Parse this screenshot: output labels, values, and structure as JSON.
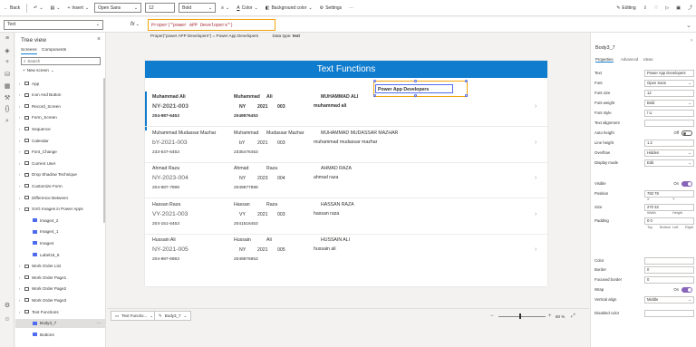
{
  "toolbar": {
    "back": "Back",
    "insert": "Insert",
    "font_family": "Open Sans",
    "font_size": "12",
    "font_weight": "Bold",
    "color": "Color",
    "background_color": "Background color",
    "settings": "Settings",
    "editing": "Editing"
  },
  "formula_bar": {
    "property": "Text",
    "fx": "fx",
    "formula": "Proper(\"power APP Developers\")",
    "hint": "Proper(\"power APP Developers\") = Power App Developers",
    "datatype_label": "Data type:",
    "datatype_value": "text"
  },
  "tree": {
    "title": "Tree view",
    "tab_screens": "Screens",
    "tab_components": "Components",
    "search_placeholder": "Search",
    "new_screen": "New screen",
    "items": [
      {
        "label": "App",
        "indent": 0
      },
      {
        "label": "Icon And Button",
        "indent": 0
      },
      {
        "label": "Record_Screen",
        "indent": 0
      },
      {
        "label": "Form_Screen",
        "indent": 0
      },
      {
        "label": "Sequence",
        "indent": 0
      },
      {
        "label": "Calendar",
        "indent": 0
      },
      {
        "label": "Font_Change",
        "indent": 0
      },
      {
        "label": "Current User",
        "indent": 0
      },
      {
        "label": "Drop Shadow Technique",
        "indent": 0
      },
      {
        "label": "Customize Form",
        "indent": 0
      },
      {
        "label": "Difference Between",
        "indent": 0
      },
      {
        "label": "SVG Images in Power Apps",
        "indent": 0
      },
      {
        "label": "Image4_2",
        "indent": 1
      },
      {
        "label": "Image4_1",
        "indent": 1
      },
      {
        "label": "Image4",
        "indent": 1
      },
      {
        "label": "Label16_6",
        "indent": 1
      },
      {
        "label": "Work Order List",
        "indent": 0
      },
      {
        "label": "Work Order Page1",
        "indent": 0
      },
      {
        "label": "Work Order Page2",
        "indent": 0
      },
      {
        "label": "Work Order Page3",
        "indent": 0
      },
      {
        "label": "Text Functions",
        "indent": 0
      },
      {
        "label": "Body3_7",
        "indent": 1
      },
      {
        "label": "Button4",
        "indent": 1
      }
    ]
  },
  "canvas": {
    "title": "Text Functions",
    "selected_label": "Power App Developers",
    "rows": [
      {
        "c1_name": "Muhammad Ali",
        "c1_code": "NY-2021-003",
        "c1_phone": "204-987-6453",
        "c2_first": "Muhammad",
        "c2_last": "Ali",
        "c2_a": "NY",
        "c2_b": "2021",
        "c2_c": "003",
        "c2_phone": "2049876453",
        "c3_upper": "MUHAMMAD ALI",
        "c3_lower": "muhammad ali"
      },
      {
        "c1_name": "Muhammad Mudassar Mazhar",
        "c1_code": "bY-2021-003",
        "c1_phone": "233-547-6453",
        "c2_first": "Muhammad",
        "c2_last": "Mudassar Mazhar",
        "c2_a": "bY",
        "c2_b": "2021",
        "c2_c": "003",
        "c2_phone": "2335476453",
        "c3_upper": "MUHAMMAD MUDASSAR MAZHAR",
        "c3_lower": "muhammad mudassar mazhar"
      },
      {
        "c1_name": "Ahmad Raza",
        "c1_code": "NY-2023-004",
        "c1_phone": "204-987-7898",
        "c2_first": "Ahmad",
        "c2_last": "Raza",
        "c2_a": "NY",
        "c2_b": "2023",
        "c2_c": "004",
        "c2_phone": "2049877898",
        "c3_upper": "AHMAD RAZA",
        "c3_lower": "ahmad raza"
      },
      {
        "c1_name": "Hassan Raza",
        "c1_code": "VY-2021-003",
        "c1_phone": "204-151-6453",
        "c2_first": "Hassan",
        "c2_last": "Raza",
        "c2_a": "VY",
        "c2_b": "2021",
        "c2_c": "003",
        "c2_phone": "2041516453",
        "c3_upper": "HASSAN RAZA",
        "c3_lower": "hassan raza"
      },
      {
        "c1_name": "Hussain Ali",
        "c1_code": "NY-2021-005",
        "c1_phone": "204-987-6953",
        "c2_first": "Hussain",
        "c2_last": "Ali",
        "c2_a": "NY",
        "c2_b": "2021",
        "c2_c": "005",
        "c2_phone": "2049876953",
        "c3_upper": "HUSSAIN ALI",
        "c3_lower": "hussain ali"
      }
    ]
  },
  "bottom": {
    "screen_tab": "Text Functio...",
    "control_tab": "Body3_7",
    "zoom": "60 %"
  },
  "props": {
    "control_name": "Body3_7",
    "tab_properties": "Properties",
    "tab_advanced": "Advanced",
    "tab_ideas": "Ideas",
    "rows": [
      {
        "label": "Text",
        "value": "Power App Developers"
      },
      {
        "label": "Font",
        "value": "Open Sans"
      },
      {
        "label": "Font size",
        "value": "12"
      },
      {
        "label": "Font weight",
        "value": "Bold"
      },
      {
        "label": "Font style",
        "value": "/   U"
      },
      {
        "label": "Text alignment",
        "value": ""
      },
      {
        "label": "Auto height",
        "value": "Off"
      },
      {
        "label": "Line height",
        "value": "1.2"
      },
      {
        "label": "Overflow",
        "value": "Hidden"
      },
      {
        "label": "Display mode",
        "value": "Edit"
      },
      {
        "label": "Visible",
        "value": "On"
      },
      {
        "label": "Position",
        "value": "783   78"
      },
      {
        "label": "Size",
        "value": "270   32"
      },
      {
        "label": "Padding",
        "value": "0   0"
      },
      {
        "label": "Color",
        "value": ""
      },
      {
        "label": "Border",
        "value": "0"
      },
      {
        "label": "Focused border",
        "value": "0"
      },
      {
        "label": "Wrap",
        "value": "On"
      },
      {
        "label": "Vertical align",
        "value": "Middle"
      },
      {
        "label": "Disabled color",
        "value": ""
      }
    ],
    "sub_xy": [
      "X",
      "Y"
    ],
    "sub_wh": [
      "Width",
      "Height"
    ],
    "sub_pad": [
      "Top",
      "Bottom",
      "Left",
      "Right"
    ]
  },
  "colors": {
    "accent": "#0f7ccd",
    "selection": "#f0a30a",
    "toggle": "#8764b8"
  }
}
